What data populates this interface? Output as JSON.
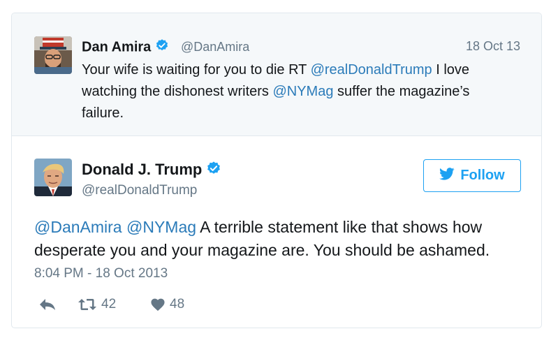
{
  "quoted": {
    "name": "Dan Amira",
    "handle": "@DanAmira",
    "date": "18 Oct 13",
    "text_prefix": "Your wife is waiting for you to die RT ",
    "mention1": "@realDonaldTrump",
    "text_mid": " I love watching the dishonest writers ",
    "mention2": "@NYMag",
    "text_suffix": " suffer the magazine’s failure."
  },
  "tweet": {
    "name": "Donald J. Trump",
    "handle": "@realDonaldTrump",
    "mention1": "@DanAmira",
    "mention2": "@NYMag",
    "text": " A terrible statement like that shows how desperate you and your magazine are. You should be ashamed.",
    "timestamp": "8:04 PM - 18 Oct 2013",
    "retweets": "42",
    "likes": "48"
  },
  "follow_button": {
    "label": "Follow"
  },
  "colors": {
    "accent": "#1da1f2",
    "link": "#2b7bb9",
    "muted": "#657786",
    "quote_bg": "#f5f8fa"
  },
  "icons": [
    "verified-badge-icon",
    "twitter-bird-icon",
    "reply-icon",
    "retweet-icon",
    "heart-icon"
  ]
}
